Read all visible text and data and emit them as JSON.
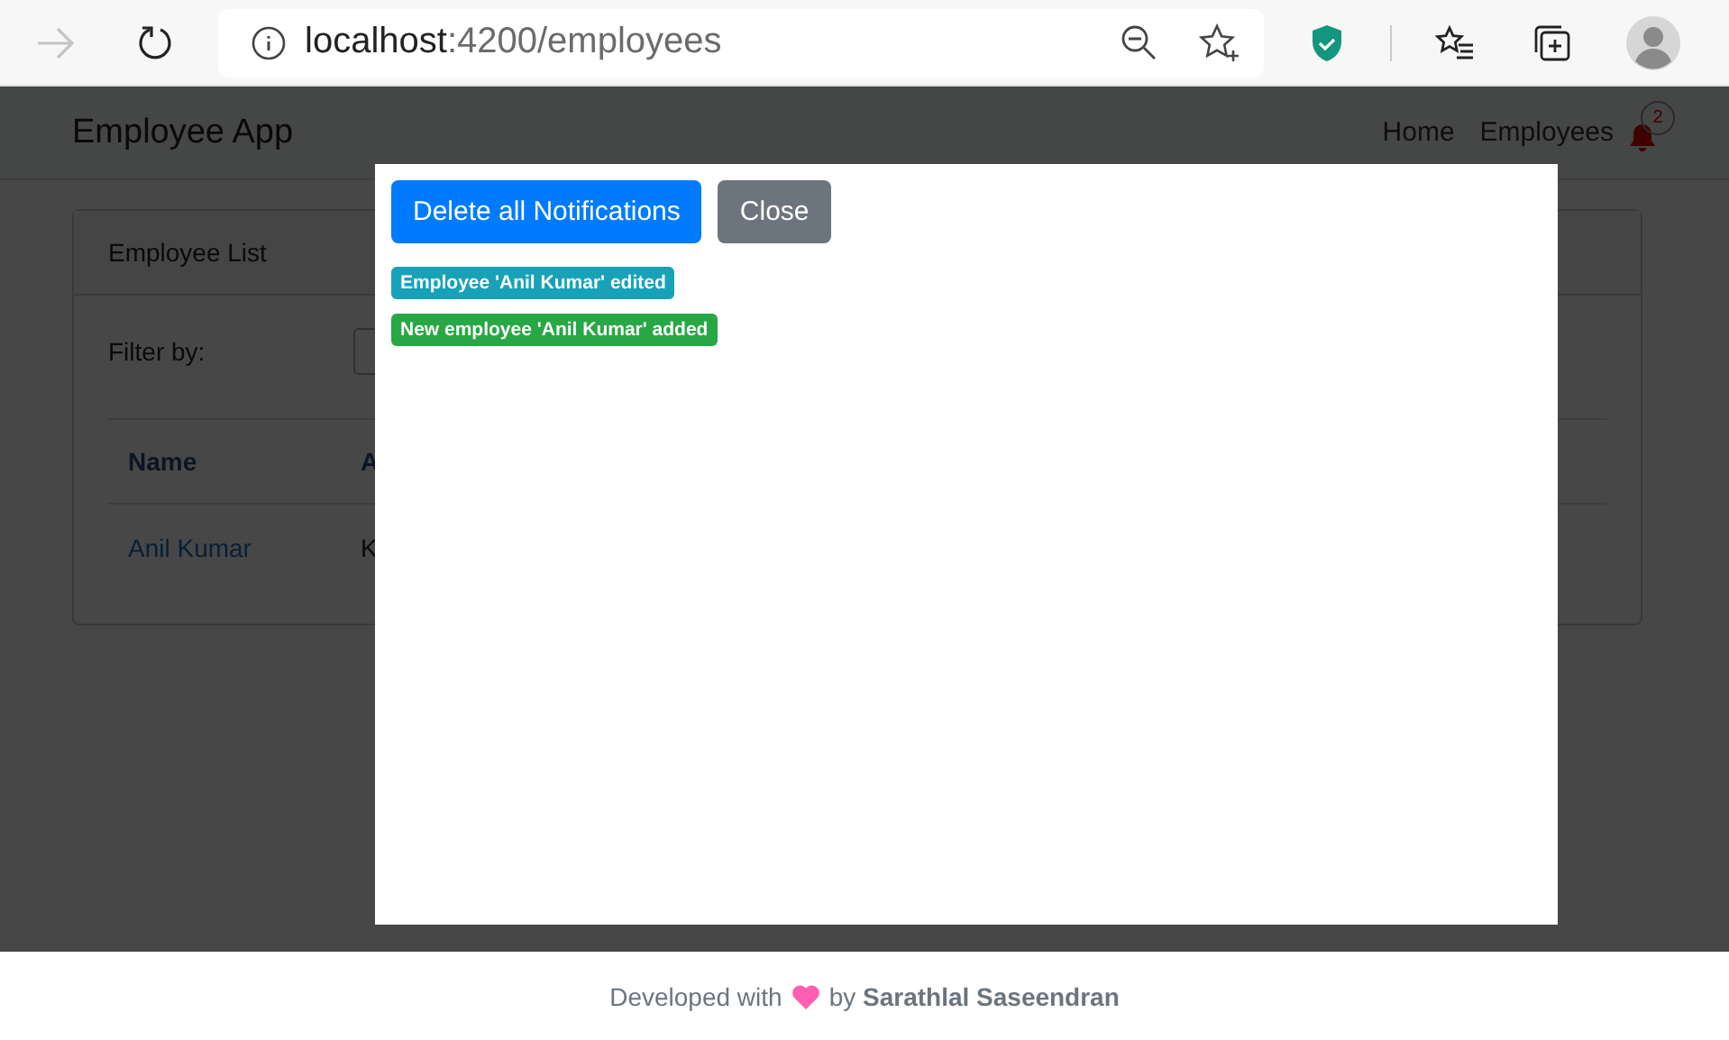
{
  "browser": {
    "url": {
      "host": "localhost",
      "path": ":4200/employees"
    }
  },
  "navbar": {
    "brand": "Employee App",
    "links": [
      "Home",
      "Employees"
    ],
    "notification_count": "2"
  },
  "card": {
    "title": "Employee List",
    "filter_label": "Filter by:",
    "table": {
      "columns": [
        "Name",
        "A"
      ],
      "rows": [
        [
          "Anil Kumar",
          "K"
        ]
      ]
    }
  },
  "modal": {
    "buttons": [
      {
        "label": "Delete all Notifications",
        "kind": "primary"
      },
      {
        "label": "Close",
        "kind": "secondary"
      }
    ],
    "notifications": [
      {
        "text": "Employee 'Anil Kumar' edited",
        "color": "#17a2b8"
      },
      {
        "text": "New employee 'Anil Kumar' added",
        "color": "#28a745"
      }
    ]
  },
  "footer": {
    "prefix": "Developed with",
    "suffix": "by **Sarathlal Saseendran**"
  }
}
